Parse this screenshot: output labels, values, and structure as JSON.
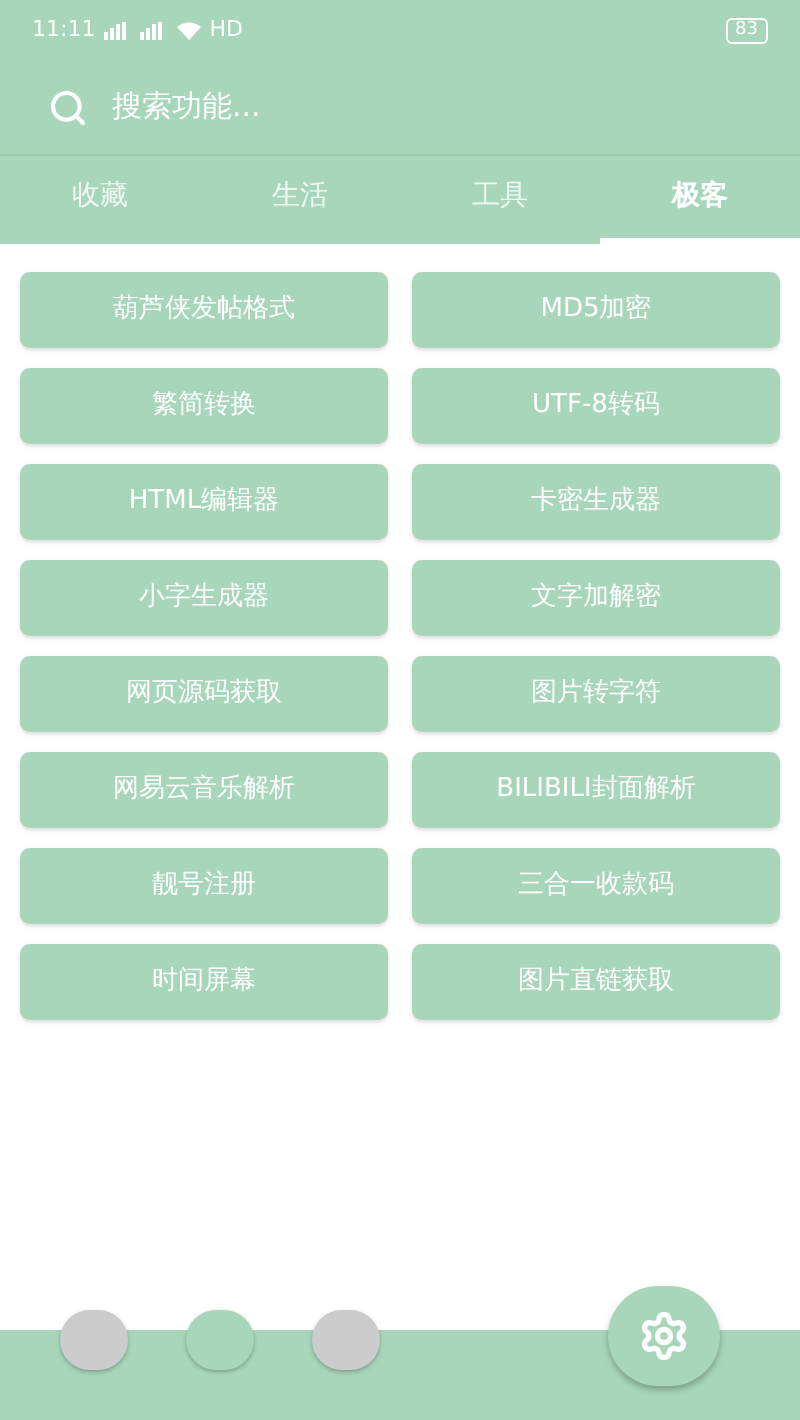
{
  "status_bar": {
    "time": "11:11",
    "network": "HD",
    "battery": "83"
  },
  "search": {
    "placeholder": "搜索功能..."
  },
  "tabs": [
    {
      "label": "收藏",
      "selected": false
    },
    {
      "label": "生活",
      "selected": false
    },
    {
      "label": "工具",
      "selected": false
    },
    {
      "label": "极客",
      "selected": true
    }
  ],
  "tools": [
    "葫芦侠发帖格式",
    "MD5加密",
    "繁简转换",
    "UTF-8转码",
    "HTML编辑器",
    "卡密生成器",
    "小字生成器",
    "文字加解密",
    "网页源码获取",
    "图片转字符",
    "网易云音乐解析",
    "BILIBILI封面解析",
    "靓号注册",
    "三合一收款码",
    "时间屏幕",
    "图片直链获取"
  ],
  "page_dots": [
    {
      "selected": false
    },
    {
      "selected": true
    },
    {
      "selected": false
    }
  ]
}
